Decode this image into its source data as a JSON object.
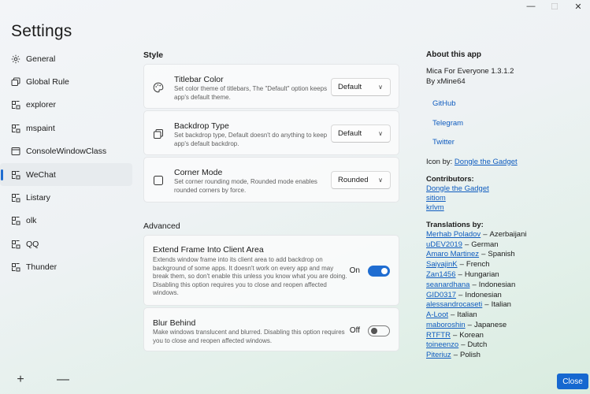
{
  "window": {
    "title": "Settings",
    "caption": {
      "minimize": "—",
      "maximize": "☐",
      "close": "✕"
    }
  },
  "sidebar": {
    "items": [
      {
        "label": "General",
        "icon": "gear-icon"
      },
      {
        "label": "Global Rule",
        "icon": "window-stack-icon"
      },
      {
        "label": "explorer",
        "icon": "app-window-icon"
      },
      {
        "label": "mspaint",
        "icon": "app-window-icon"
      },
      {
        "label": "ConsoleWindowClass",
        "icon": "window-icon"
      },
      {
        "label": "WeChat",
        "icon": "app-window-icon",
        "selected": true
      },
      {
        "label": "Listary",
        "icon": "app-window-icon"
      },
      {
        "label": "olk",
        "icon": "app-window-icon"
      },
      {
        "label": "QQ",
        "icon": "app-window-icon"
      },
      {
        "label": "Thunder",
        "icon": "app-window-icon"
      }
    ],
    "add_label": "+",
    "remove_label": "—"
  },
  "style": {
    "heading": "Style",
    "titlebar": {
      "title": "Titlebar Color",
      "desc": "Set color theme of titlebars, The \"Default\" option keeps app's default theme.",
      "value": "Default",
      "icon": "palette-icon"
    },
    "backdrop": {
      "title": "Backdrop Type",
      "desc": "Set backdrop type, Default doesn't do anything to keep app's default backdrop.",
      "value": "Default",
      "icon": "layers-icon"
    },
    "corner": {
      "title": "Corner Mode",
      "desc": "Set corner rounding mode, Rounded mode enables rounded corners by force.",
      "value": "Rounded",
      "icon": "rounded-square-icon"
    }
  },
  "advanced": {
    "heading": "Advanced",
    "extend": {
      "title": "Extend Frame Into Client Area",
      "desc": "Extends window frame into its client area to add backdrop on background of some apps. It doesn't work on every app and may break them, so don't enable this unless you know what you are doing. Disabling this option requires you to close and reopen affected windows.",
      "state": "On",
      "on": true
    },
    "blur": {
      "title": "Blur Behind",
      "desc": "Make windows translucent and blurred. Disabling this option requires you to close and reopen affected windows.",
      "state": "Off",
      "on": false
    }
  },
  "about": {
    "heading": "About this app",
    "app_name": "Mica For Everyone 1.3.1.2",
    "author": "By xMine64",
    "links": [
      "GitHub",
      "Telegram",
      "Twitter"
    ],
    "icon_by_label": "Icon by:",
    "icon_by_name": "Dongle the Gadget",
    "contributors_heading": "Contributors:",
    "contributors": [
      "Dongle the Gadget",
      "sitiom",
      "krlvm"
    ],
    "translations_heading": "Translations by:",
    "translations": [
      {
        "name": "Merhab Poladov",
        "lang": "Azerbaijani"
      },
      {
        "name": "uDEV2019",
        "lang": "German"
      },
      {
        "name": "Amaro Martinez",
        "lang": "Spanish"
      },
      {
        "name": "SaiyajinK",
        "lang": "French"
      },
      {
        "name": "Zan1456",
        "lang": "Hungarian"
      },
      {
        "name": "seanardhana",
        "lang": "Indonesian"
      },
      {
        "name": "GID0317",
        "lang": "Indonesian"
      },
      {
        "name": "alessandrocaseti",
        "lang": "Italian"
      },
      {
        "name": "A-Loot",
        "lang": "Italian"
      },
      {
        "name": "maboroshin",
        "lang": "Japanese"
      },
      {
        "name": "RTFTR",
        "lang": "Korean"
      },
      {
        "name": "toineenzo",
        "lang": "Dutch"
      },
      {
        "name": "Piteriuz",
        "lang": "Polish"
      }
    ],
    "dash": "–"
  },
  "footer": {
    "close_label": "Close"
  },
  "colors": {
    "accent": "#1f6dd1",
    "link": "#0f5cbf"
  }
}
